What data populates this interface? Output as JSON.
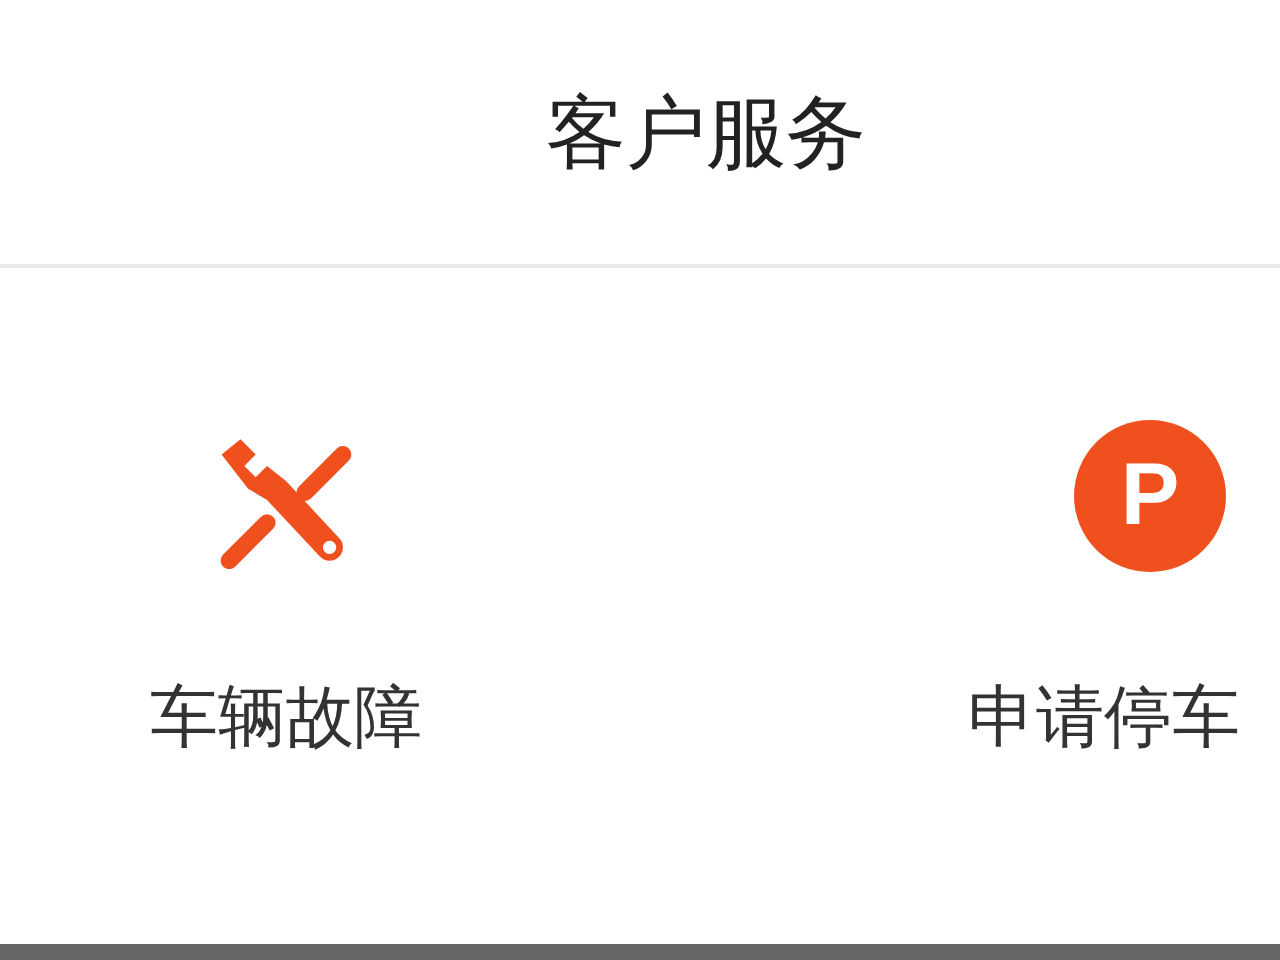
{
  "header": {
    "title": "客户服务"
  },
  "services": [
    {
      "kind": "repair",
      "label": "车辆故障"
    },
    {
      "kind": "parking",
      "glyph": "P",
      "label": "申请停车"
    }
  ]
}
